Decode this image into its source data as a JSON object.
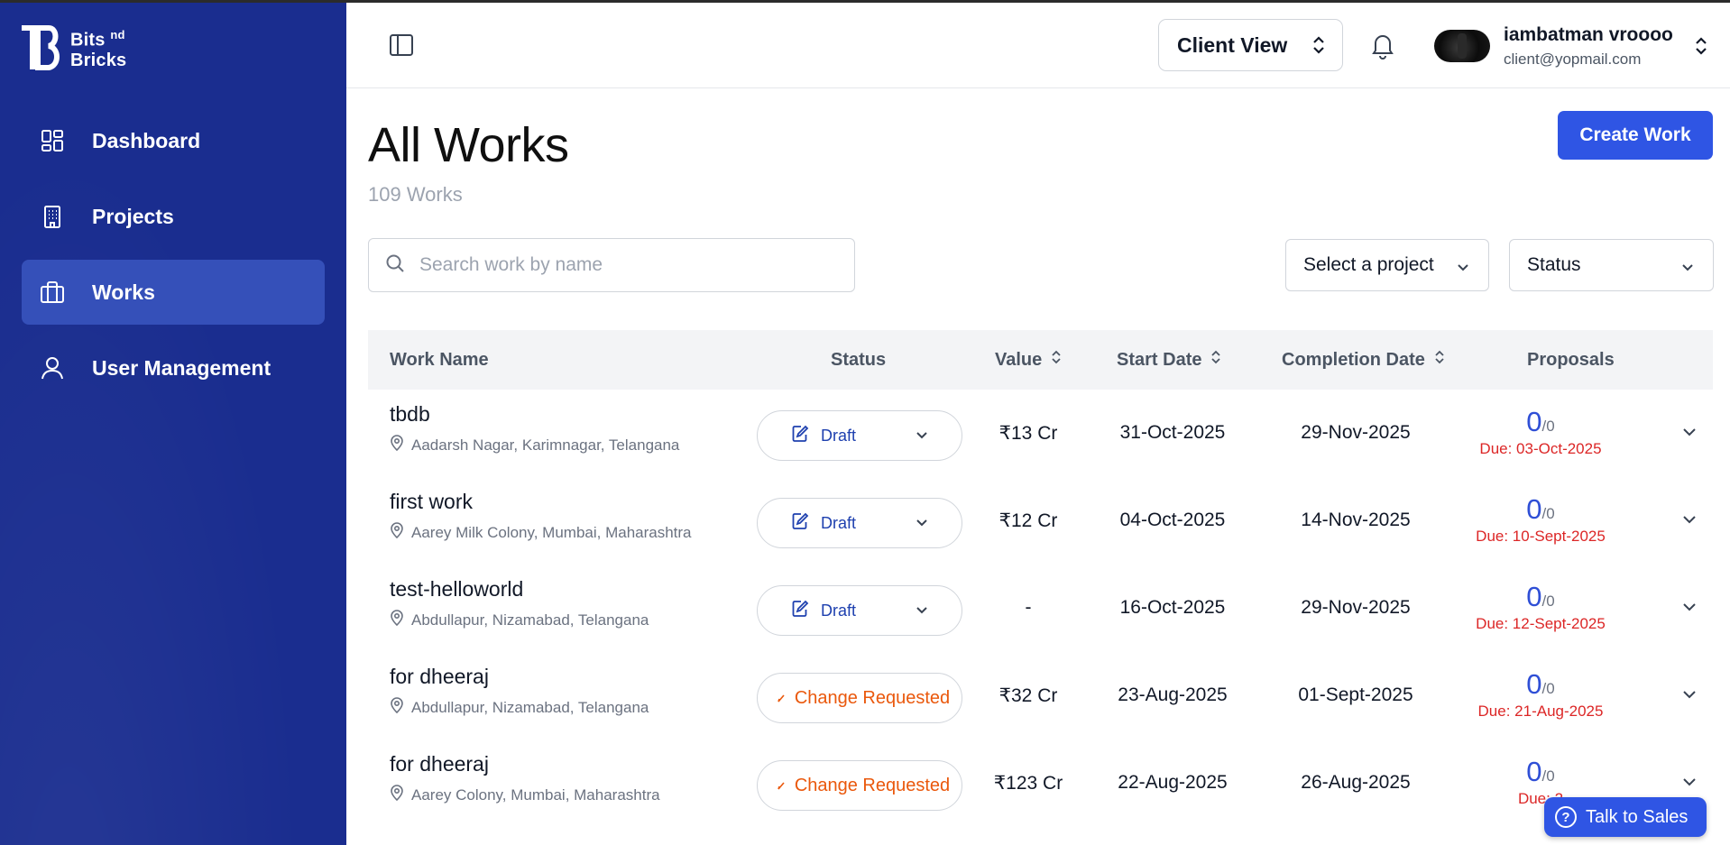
{
  "brand": {
    "name_line1": "Bits",
    "name_sup": "nd",
    "name_line2": "Bricks"
  },
  "sidebar": {
    "items": [
      {
        "label": "Dashboard",
        "icon": "dashboard-grid-icon",
        "active": false
      },
      {
        "label": "Projects",
        "icon": "building-icon",
        "active": false
      },
      {
        "label": "Works",
        "icon": "briefcase-icon",
        "active": true
      },
      {
        "label": "User Management",
        "icon": "user-icon",
        "active": false
      }
    ]
  },
  "header": {
    "view_switch": "Client View",
    "user": {
      "name": "iambatman vroooo",
      "email": "client@yopmail.com"
    }
  },
  "main": {
    "title": "All Works",
    "subtitle": "109 Works",
    "create_button": "Create Work",
    "search_placeholder": "Search work by name",
    "project_select": "Select a project",
    "status_select": "Status"
  },
  "table": {
    "columns": [
      "Work Name",
      "Status",
      "Value",
      "Start Date",
      "Completion Date",
      "Proposals"
    ],
    "rows": [
      {
        "name": "tbdb",
        "location": "Aadarsh Nagar, Karimnagar, Telangana",
        "status": "Draft",
        "value": "₹13 Cr",
        "start": "31-Oct-2025",
        "completion": "29-Nov-2025",
        "proposals": "0",
        "proposals_total": "/0",
        "due": "Due: 03-Oct-2025"
      },
      {
        "name": "first work",
        "location": "Aarey Milk Colony, Mumbai, Maharashtra",
        "status": "Draft",
        "value": "₹12 Cr",
        "start": "04-Oct-2025",
        "completion": "14-Nov-2025",
        "proposals": "0",
        "proposals_total": "/0",
        "due": "Due: 10-Sept-2025"
      },
      {
        "name": "test-helloworld",
        "location": "Abdullapur, Nizamabad, Telangana",
        "status": "Draft",
        "value": "-",
        "start": "16-Oct-2025",
        "completion": "29-Nov-2025",
        "proposals": "0",
        "proposals_total": "/0",
        "due": "Due: 12-Sept-2025"
      },
      {
        "name": "for dheeraj",
        "location": "Abdullapur, Nizamabad, Telangana",
        "status": "Change Requested",
        "value": "₹32 Cr",
        "start": "23-Aug-2025",
        "completion": "01-Sept-2025",
        "proposals": "0",
        "proposals_total": "/0",
        "due": "Due: 21-Aug-2025"
      },
      {
        "name": "for dheeraj",
        "location": "Aarey Colony, Mumbai, Maharashtra",
        "status": "Change Requested",
        "value": "₹123 Cr",
        "start": "22-Aug-2025",
        "completion": "26-Aug-2025",
        "proposals": "0",
        "proposals_total": "/0",
        "due": "Due: 2"
      }
    ]
  },
  "talk_to_sales": "Talk to Sales",
  "colors": {
    "sidebar": "#1a2d8f",
    "active_nav": "#3550b9",
    "primary": "#2f55e4",
    "draft": "#1e40af",
    "change_requested": "#ea580c",
    "due": "#dc2626"
  }
}
